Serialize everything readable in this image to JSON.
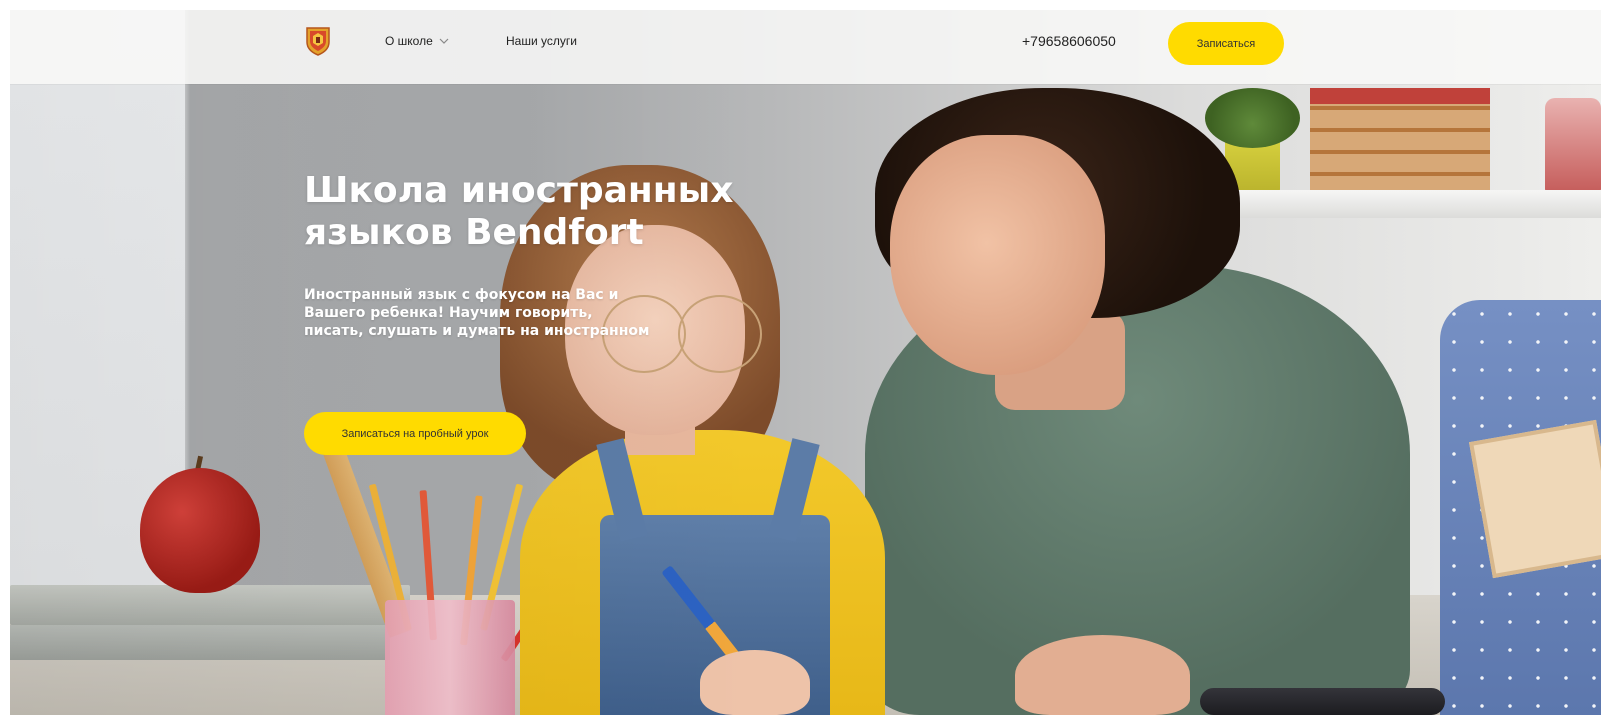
{
  "header": {
    "nav": [
      {
        "label": "О школе",
        "has_dropdown": true
      },
      {
        "label": "Наши услуги",
        "has_dropdown": false
      }
    ],
    "phone": "+79658606050",
    "signup_button": "Записаться"
  },
  "hero": {
    "title": "Школа иностранных языков Bendfort",
    "subtitle": "Иностранный язык с фокусом на Вас и Вашего ребенка! Научим говорить, писать, слушать и думать на иностранном",
    "cta_button": "Записаться на пробный урок"
  },
  "colors": {
    "accent": "#ffdb00",
    "header_bg": "#f8f8f7",
    "hero_text": "#ffffff"
  },
  "icons": {
    "logo": "school-crest-icon",
    "dropdown": "chevron-down-icon"
  }
}
